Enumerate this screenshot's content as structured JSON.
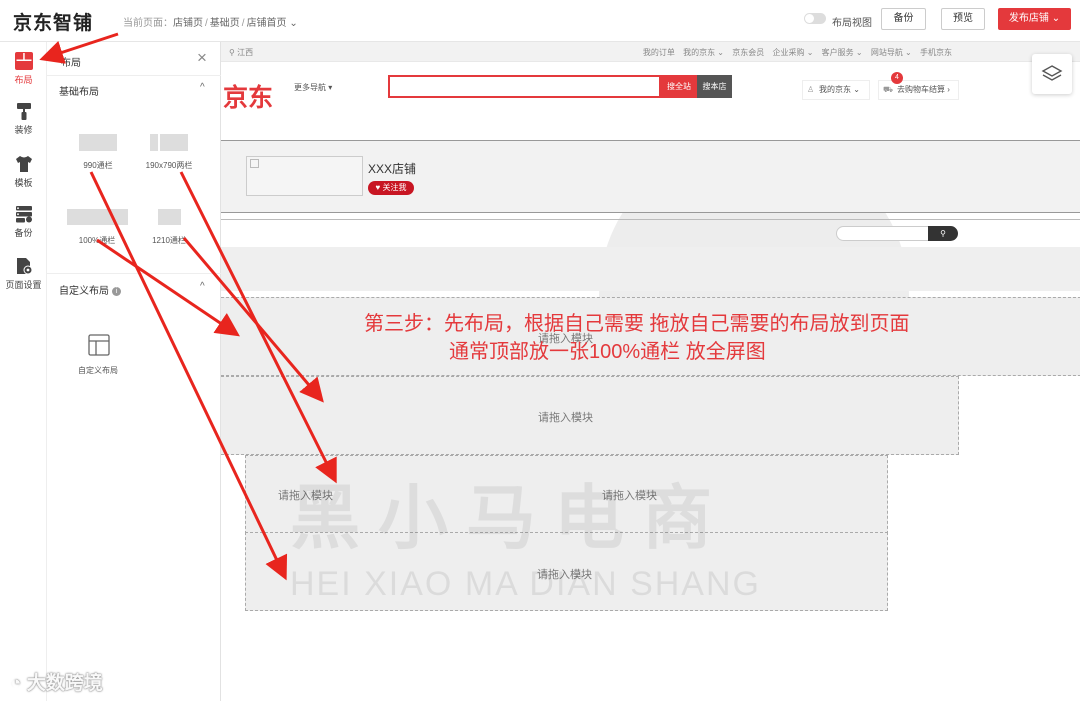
{
  "header": {
    "logo": "京东智铺",
    "breadcrumb_prefix": "当前页面：",
    "breadcrumb": [
      "店铺页",
      "基础页",
      "店铺首页"
    ],
    "breadcrumb_caret": "⌄",
    "layout_view_label": "布局视图",
    "backup_label": "备份",
    "preview_label": "预览",
    "publish_label": "发布店铺",
    "publish_caret": "⌄"
  },
  "iconbar": {
    "items": [
      {
        "label": "布局",
        "icon": "layout-icon",
        "active": true
      },
      {
        "label": "装修",
        "icon": "paint-roller-icon"
      },
      {
        "label": "模板",
        "icon": "tshirt-icon"
      },
      {
        "label": "备份",
        "icon": "backup-icon"
      },
      {
        "label": "页面设置",
        "icon": "page-settings-icon"
      }
    ]
  },
  "panel": {
    "title": "布局",
    "close": "×",
    "basic_section": "基础布局",
    "basic_caret": "^",
    "layouts": [
      {
        "label": "990通栏"
      },
      {
        "label": "190x790两栏"
      },
      {
        "label": "100%通栏"
      },
      {
        "label": "1210通栏"
      }
    ],
    "custom_section": "自定义布局",
    "custom_info": "i",
    "custom_caret": "^",
    "custom_item": "自定义布局"
  },
  "site": {
    "location": "江西",
    "top_links": [
      "我的订单",
      "我的京东 ⌄",
      "京东会员",
      "企业采购 ⌄",
      "客户服务 ⌄",
      "网站导航 ⌄",
      "手机京东"
    ],
    "logo": "京东",
    "more_nav": "更多导航 ▾",
    "search_all": "搜全站",
    "search_shop": "搜本店",
    "my_jd": "我的京东  ⌄",
    "cart": "去购物车结算  ›",
    "cart_count": "4",
    "shop_name": "XXX店铺",
    "follow": "♥ 关注我"
  },
  "dropzones": {
    "label": "请拖入模块"
  },
  "annotation": {
    "line1": "第三步：先布局，根据自己需要 拖放自己需要的布局放到页面",
    "line2": "通常顶部放一张100%通栏  放全屏图"
  },
  "watermark": {
    "main": "黑小马电商",
    "sub": "HEI XIAO MA DIAN SHANG",
    "corner": "大数跨境"
  },
  "colors": {
    "accent": "#e4393c",
    "follow": "#c81623"
  }
}
